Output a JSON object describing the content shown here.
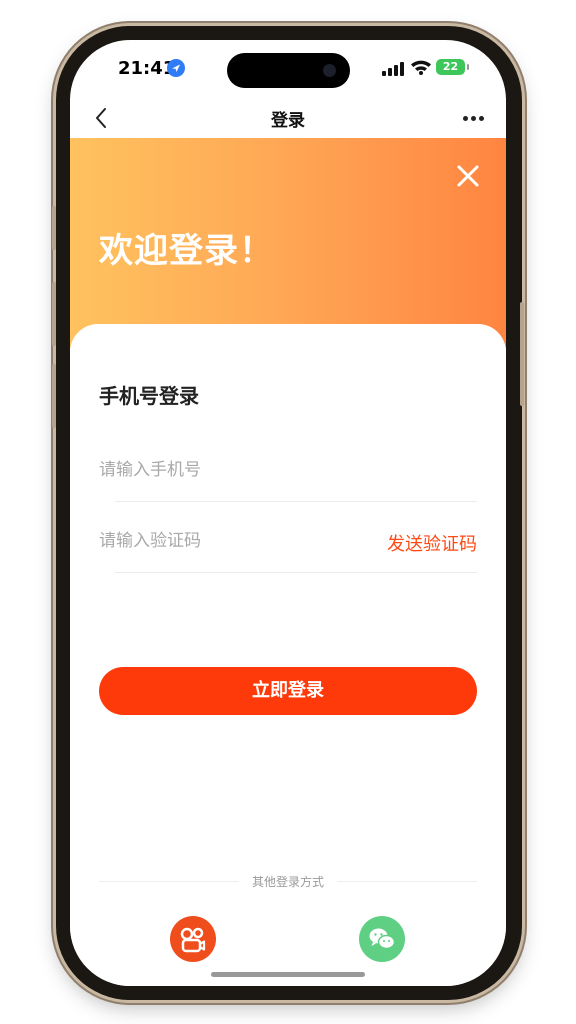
{
  "status_bar": {
    "time": "21:41",
    "battery": "22"
  },
  "nav": {
    "title": "登录"
  },
  "banner": {
    "welcome": "欢迎登录！"
  },
  "form": {
    "section_title": "手机号登录",
    "phone_placeholder": "请输入手机号",
    "code_placeholder": "请输入验证码",
    "send_code": "发送验证码",
    "login_button": "立即登录"
  },
  "other_login": {
    "label": "其他登录方式",
    "options": [
      {
        "icon": "kuaishou-icon",
        "color": "#f04d1c"
      },
      {
        "icon": "wechat-icon",
        "color": "#5fcf83"
      }
    ]
  },
  "colors": {
    "accent": "#ff3a0a",
    "link": "#ff4a14",
    "banner_start": "#ffc25f",
    "banner_end": "#ff8540"
  }
}
